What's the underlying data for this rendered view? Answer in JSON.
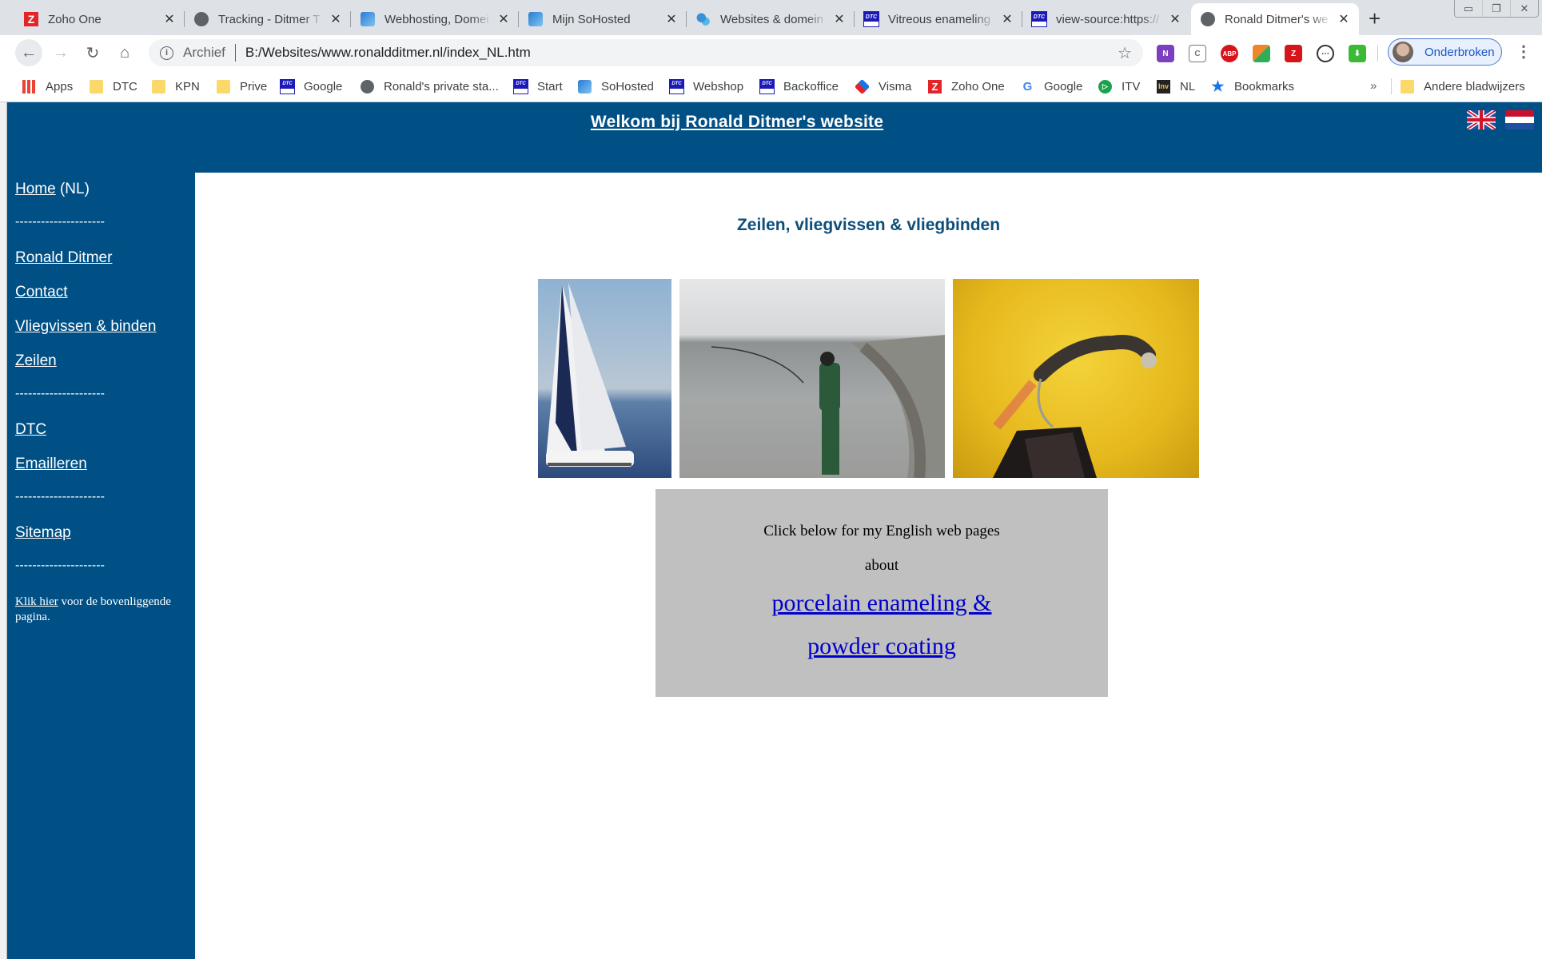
{
  "browser": {
    "tabs": [
      {
        "title": "Zoho One",
        "icon": "zoho-icon",
        "active": false
      },
      {
        "title": "Tracking - Ditmer T",
        "icon": "globe-icon",
        "active": false
      },
      {
        "title": "Webhosting, Domei",
        "icon": "sohosted-icon",
        "active": false
      },
      {
        "title": "Mijn SoHosted",
        "icon": "sohosted-icon",
        "active": false
      },
      {
        "title": "Websites & domein",
        "icon": "gears-icon",
        "active": false
      },
      {
        "title": "Vitreous enameling",
        "icon": "dtc-icon",
        "active": false
      },
      {
        "title": "view-source:https://",
        "icon": "dtc-icon",
        "active": false
      },
      {
        "title": "Ronald Ditmer's we",
        "icon": "globe-icon",
        "active": true
      }
    ],
    "new_tab_label": "+",
    "window_controls": {
      "minimize": "▭",
      "restore": "❐",
      "close": "✕"
    },
    "omnibox": {
      "scheme_label": "Archief",
      "url": "B:/Websites/www.ronaldditmer.nl/index_NL.htm"
    },
    "extensions": [
      {
        "name": "onenote-extension-icon",
        "label": "N",
        "color": "#7b3fbf"
      },
      {
        "name": "calendar-extension-icon",
        "label": "C",
        "color": "#ffffff"
      },
      {
        "name": "adblock-plus-extension-icon",
        "label": "ABP",
        "color": "#d7141a"
      },
      {
        "name": "colorful-extension-icon",
        "label": "",
        "color": "#f0862a"
      },
      {
        "name": "zoho-extension-icon",
        "label": "Z",
        "color": "#d7141a"
      },
      {
        "name": "chat-extension-icon",
        "label": "⋯",
        "color": "#ffffff"
      },
      {
        "name": "download-extension-icon",
        "label": "⬇",
        "color": "#3cba35"
      }
    ],
    "profile": {
      "name": "Onderbroken"
    },
    "bookmarks": [
      {
        "label": "Apps",
        "icon": "apps-icon"
      },
      {
        "label": "DTC",
        "icon": "folder-icon"
      },
      {
        "label": "KPN",
        "icon": "folder-icon"
      },
      {
        "label": "Prive",
        "icon": "folder-icon"
      },
      {
        "label": "Google",
        "icon": "dtc-icon"
      },
      {
        "label": "Ronald's private sta...",
        "icon": "globe-icon"
      },
      {
        "label": "Start",
        "icon": "dtc-icon"
      },
      {
        "label": "SoHosted",
        "icon": "sohosted-icon"
      },
      {
        "label": "Webshop",
        "icon": "dtc-icon"
      },
      {
        "label": "Backoffice",
        "icon": "dtc-icon"
      },
      {
        "label": "Visma",
        "icon": "visma-icon"
      },
      {
        "label": "Zoho One",
        "icon": "zoho-icon"
      },
      {
        "label": "Google",
        "icon": "google-icon"
      },
      {
        "label": "ITV",
        "icon": "itv-icon"
      },
      {
        "label": "NL",
        "icon": "inv-icon"
      },
      {
        "label": "Bookmarks",
        "icon": "star-icon"
      }
    ],
    "bookmarks_overflow": "»",
    "other_bookmarks": "Andere bladwijzers"
  },
  "page": {
    "header_title": "Welkom bij Ronald Ditmer's website",
    "colors": {
      "brand_blue": "#005086",
      "title_blue": "#0d4e7b",
      "box_grey": "#c0c0c0",
      "link_blue": "#0000cc"
    },
    "sidebar": {
      "home_link": "Home",
      "home_suffix": " (NL)",
      "separator": "---------------------",
      "items": [
        "Ronald Ditmer",
        "Contact",
        "Vliegvissen & binden",
        "Zeilen",
        "DTC",
        "Emailleren",
        "Sitemap"
      ],
      "footer_link": "Klik hier",
      "footer_text": " voor de bovenliggende pagina."
    },
    "content_title": "Zeilen, vliegvissen & vliegbinden",
    "photos": [
      {
        "subject": "sailboat"
      },
      {
        "subject": "fly fisherman wading"
      },
      {
        "subject": "tied fly in vise"
      }
    ],
    "english_box": {
      "line1": "Click below for my English web pages",
      "line2": "about",
      "link1": "porcelain enameling &",
      "link2": "powder coating"
    }
  }
}
